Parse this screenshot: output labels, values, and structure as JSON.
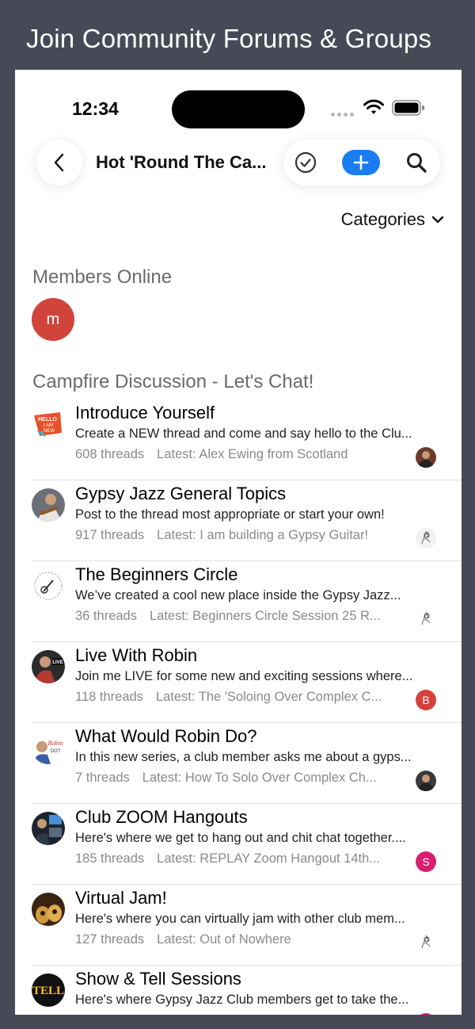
{
  "banner": {
    "text": "Join Community Forums & Groups"
  },
  "status_bar": {
    "time": "12:34"
  },
  "nav": {
    "title": "Hot 'Round The Ca..."
  },
  "categories_label": "Categories",
  "members_online": {
    "heading": "Members Online",
    "avatar_letter": "m",
    "avatar_color": "#d0443c"
  },
  "section": {
    "heading": "Campfire Discussion - Let's Chat!"
  },
  "forums": [
    {
      "title": "Introduce Yourself",
      "description": "Create a NEW thread and come and say hello to the Clu...",
      "threads": "608 threads",
      "latest": "Latest: Alex Ewing from Scotland",
      "icon": "hello-badge-icon",
      "user_avatar": {
        "type": "photo",
        "letter": "",
        "color": "#6b3a2a"
      }
    },
    {
      "title": "Gypsy Jazz General Topics",
      "description": "Post to the thread most appropriate or start your own!",
      "threads": "917 threads",
      "latest": "Latest: I am building a Gypsy Guitar!",
      "icon": "guitarist-photo-icon",
      "user_avatar": {
        "type": "sketch",
        "letter": "",
        "color": "#f2f2f2"
      }
    },
    {
      "title": "The Beginners Circle",
      "description": "We’ve created a cool new place inside the Gypsy Jazz...",
      "threads": "36 threads",
      "latest": "Latest: Beginners Circle Session 25 R...",
      "icon": "beginners-circle-logo-icon",
      "user_avatar": {
        "type": "sketch",
        "letter": "",
        "color": "#ffffff"
      }
    },
    {
      "title": "Live With Robin",
      "description": "Join me LIVE for some new and exciting sessions where...",
      "threads": "118 threads",
      "latest": "Latest: The 'Soloing Over Complex C...",
      "icon": "live-photo-icon",
      "user_avatar": {
        "type": "letter",
        "letter": "B",
        "color": "#d6423a"
      }
    },
    {
      "title": "What Would Robin Do?",
      "description": "In this new series, a club member asks me about a gyps...",
      "threads": "7 threads",
      "latest": "Latest: How To Solo Over Complex Ch...",
      "icon": "robin-do-logo-icon",
      "user_avatar": {
        "type": "photo",
        "letter": "",
        "color": "#3a3a3a"
      }
    },
    {
      "title": "Club ZOOM Hangouts",
      "description": "Here's where we get to hang out and chit chat together....",
      "threads": "185 threads",
      "latest": "Latest: REPLAY Zoom Hangout 14th...",
      "icon": "zoom-photo-icon",
      "user_avatar": {
        "type": "letter",
        "letter": "S",
        "color": "#d91f6f"
      }
    },
    {
      "title": "Virtual Jam!",
      "description": "Here's where you can virtually jam with other club mem...",
      "threads": "127 threads",
      "latest": "Latest: Out of Nowhere",
      "icon": "guitars-photo-icon",
      "user_avatar": {
        "type": "sketch",
        "letter": "",
        "color": "#ffffff"
      }
    },
    {
      "title": "Show & Tell Sessions",
      "description": "Here's where Gypsy Jazz Club members get to take the...",
      "threads": "",
      "latest": "",
      "icon": "tell-logo-icon",
      "user_avatar": {
        "type": "letter",
        "letter": "",
        "color": "#d91f6f"
      }
    }
  ],
  "colors": {
    "background": "#474a56",
    "accent": "#1a7cf2",
    "secondary_text": "#8a8a8a"
  }
}
